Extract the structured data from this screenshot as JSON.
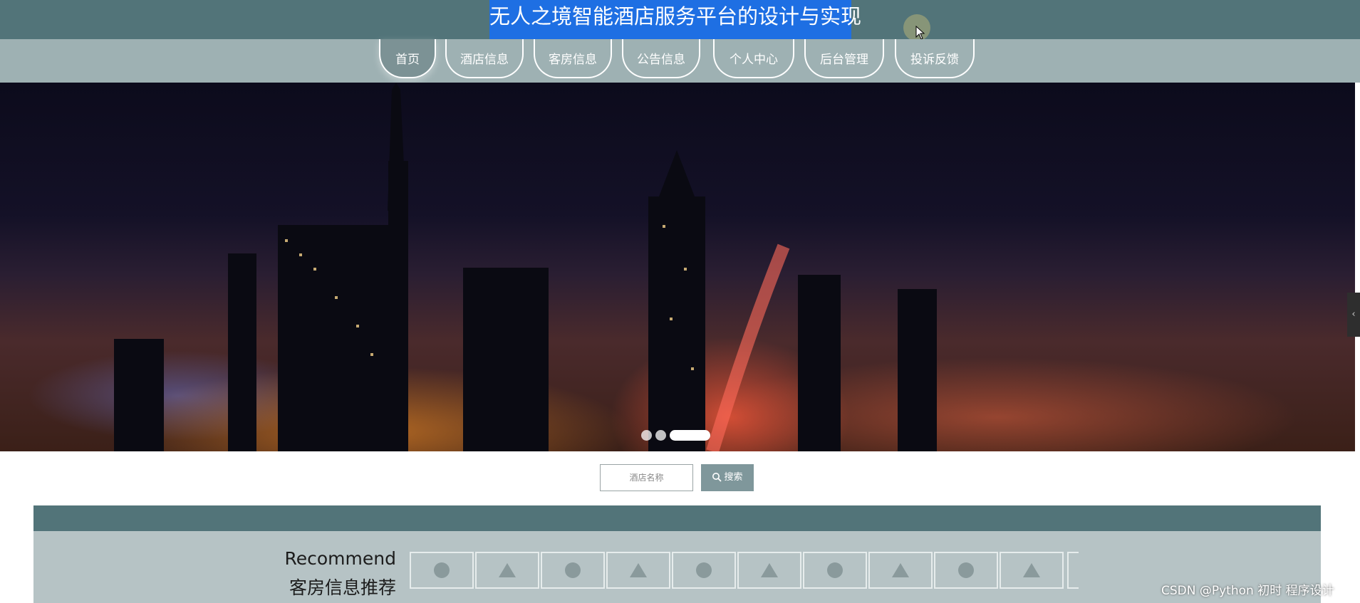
{
  "header": {
    "title": "无人之境智能酒店服务平台的设计与实现"
  },
  "nav": {
    "items": [
      {
        "label": "首页",
        "active": true
      },
      {
        "label": "酒店信息",
        "active": false
      },
      {
        "label": "客房信息",
        "active": false
      },
      {
        "label": "公告信息",
        "active": false
      },
      {
        "label": "个人中心",
        "active": false
      },
      {
        "label": "后台管理",
        "active": false
      },
      {
        "label": "投诉反馈",
        "active": false
      }
    ]
  },
  "carousel": {
    "slide_count": 3,
    "active_index": 2
  },
  "search": {
    "placeholder": "酒店名称",
    "button_label": "搜索"
  },
  "recommend": {
    "title_en": "Recommend",
    "title_cn": "客房信息推荐",
    "thumbnails": [
      "circle",
      "triangle",
      "circle",
      "triangle",
      "circle",
      "triangle",
      "circle",
      "triangle",
      "circle",
      "triangle"
    ]
  },
  "watermark": "CSDN @Python 初时 程序设计",
  "colors": {
    "header_bg": "#527479",
    "nav_bg": "#9eb1b3",
    "title_highlight": "#1e6fe3",
    "section_bg": "#b6c3c5"
  }
}
